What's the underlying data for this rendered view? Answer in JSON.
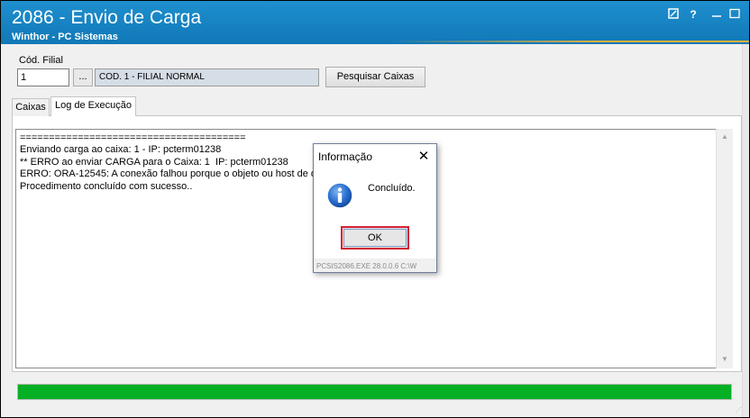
{
  "window": {
    "title": "2086 - Envio de Carga",
    "subtitle": "Winthor - PC Sistemas",
    "controls": {
      "note_icon": "note-icon",
      "help_label": "?",
      "minimize_icon": "minimize-icon",
      "maximize_icon": "maximize-icon"
    }
  },
  "filial": {
    "label": "Cód. Filial",
    "value": "1",
    "lookup_label": "...",
    "description": "COD. 1 - FILIAL NORMAL"
  },
  "toolbar": {
    "pesquisar_label": "Pesquisar Caixas"
  },
  "tabs": [
    {
      "label": "Caixas",
      "active": false
    },
    {
      "label": "Log de Execução",
      "active": true
    }
  ],
  "log": {
    "lines": [
      "=======================================",
      "Enviando carga ao caixa: 1 - IP: pcterm01238",
      "** ERRO ao enviar CARGA para o Caixa: 1  IP: pcterm01238",
      "ERRO: ORA-12545: A conexão falhou porque o objeto ou host de d",
      "Procedimento concluído com sucesso.."
    ]
  },
  "progress": {
    "percent": 100,
    "color": "#06b025"
  },
  "dialog": {
    "title": "Informação",
    "close_label": "✕",
    "icon": "info-icon",
    "message": "Concluído.",
    "ok_label": "OK",
    "footer": "PCSIS2086.EXE 28.0.0.6 C:\\W"
  },
  "colors": {
    "titlebar": "#1178b6",
    "ok_highlight": "#d22234",
    "filial_desc_bg": "#d5dde6"
  }
}
